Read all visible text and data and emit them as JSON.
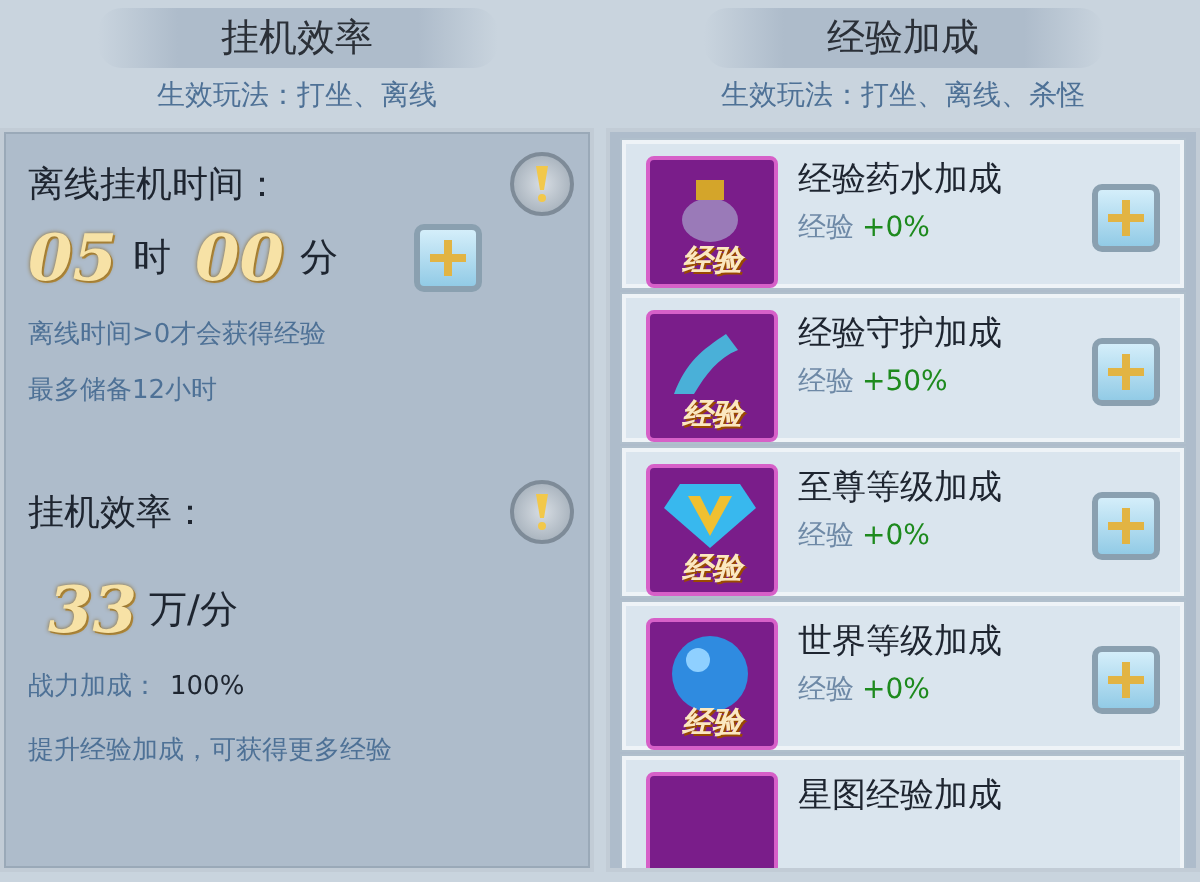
{
  "left": {
    "title": "挂机效率",
    "subtitle": "生效玩法：打坐、离线",
    "offline": {
      "label": "离线挂机时间：",
      "hours": "05",
      "hours_unit": "时",
      "minutes": "00",
      "minutes_unit": "分",
      "notes": [
        "离线时间>0才会获得经验",
        "最多储备12小时"
      ]
    },
    "efficiency": {
      "label": "挂机效率：",
      "value": "33",
      "unit": "万/分",
      "power_label": "战力加成：",
      "power_value": "100%",
      "hint": "提升经验加成，可获得更多经验"
    }
  },
  "right": {
    "title": "经验加成",
    "subtitle": "生效玩法：打坐、离线、杀怪",
    "items": [
      {
        "name": "经验药水加成",
        "stat": "经验",
        "bonus": "+0%",
        "badge": "经验",
        "kind": "potion"
      },
      {
        "name": "经验守护加成",
        "stat": "经验",
        "bonus": "+50%",
        "badge": "经验",
        "kind": "dragon"
      },
      {
        "name": "至尊等级加成",
        "stat": "经验",
        "bonus": "+0%",
        "badge": "经验",
        "kind": "gem"
      },
      {
        "name": "世界等级加成",
        "stat": "经验",
        "bonus": "+0%",
        "badge": "经验",
        "kind": "orb"
      },
      {
        "name": "星图经验加成",
        "kind": "partial"
      }
    ]
  }
}
